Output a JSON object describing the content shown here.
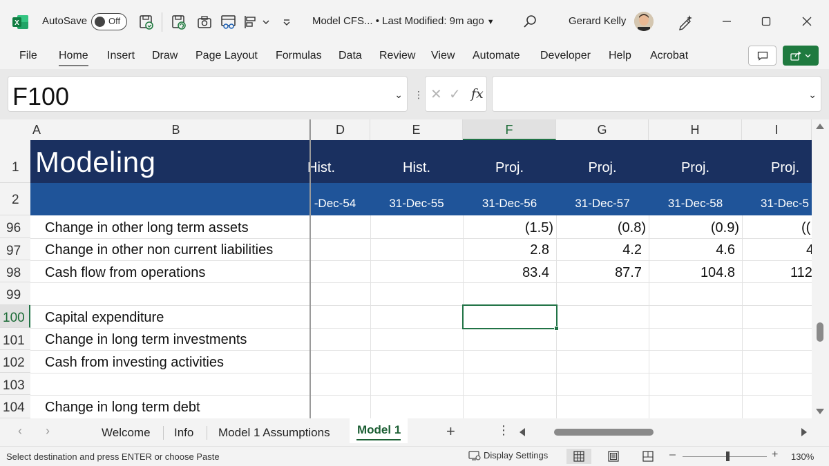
{
  "titlebar": {
    "autosave_label": "AutoSave",
    "autosave_state": "Off",
    "doc_title": "Model CFS... • Last Modified: 9m ago",
    "user_name": "Gerard Kelly",
    "brand_color": "#1f7a3f"
  },
  "ribbon": {
    "tabs": [
      "File",
      "Home",
      "Insert",
      "Draw",
      "Page Layout",
      "Formulas",
      "Data",
      "Review",
      "View",
      "Automate",
      "Developer",
      "Help",
      "Acrobat"
    ],
    "active_tab": "Home"
  },
  "formula_bar": {
    "name_box": "F100",
    "formula_value": ""
  },
  "grid": {
    "columns": [
      "A",
      "B",
      "D",
      "E",
      "F",
      "G",
      "H",
      "I"
    ],
    "selected_column": "F",
    "title": "Modeling",
    "period_types": [
      "Hist.",
      "Hist.",
      "Proj.",
      "Proj.",
      "Proj.",
      "Proj."
    ],
    "period_dates": [
      "-Dec-54",
      "31-Dec-55",
      "31-Dec-56",
      "31-Dec-57",
      "31-Dec-58",
      "31-Dec-5"
    ],
    "header_rows": [
      "1",
      "2"
    ],
    "rows": [
      {
        "num": "96",
        "label": "Change in other long term assets",
        "values": [
          "(1.5)",
          "(0.8)",
          "(0.9)",
          "(("
        ]
      },
      {
        "num": "97",
        "label": "Change in other non current liabilities",
        "values": [
          "2.8",
          "4.2",
          "4.6",
          "4"
        ]
      },
      {
        "num": "98",
        "label": "Cash flow from operations",
        "values": [
          "83.4",
          "87.7",
          "104.8",
          "112"
        ]
      },
      {
        "num": "99",
        "label": "",
        "values": [
          "",
          "",
          "",
          ""
        ]
      },
      {
        "num": "100",
        "label": "Capital expenditure",
        "values": [
          "",
          "",
          "",
          ""
        ]
      },
      {
        "num": "101",
        "label": "Change in long term investments",
        "values": [
          "",
          "",
          "",
          ""
        ]
      },
      {
        "num": "102",
        "label": "Cash from investing activities",
        "values": [
          "",
          "",
          "",
          ""
        ]
      },
      {
        "num": "103",
        "label": "",
        "values": [
          "",
          "",
          "",
          ""
        ]
      },
      {
        "num": "104",
        "label": "Change in long term debt",
        "values": [
          "",
          "",
          "",
          ""
        ]
      }
    ],
    "selected_row": "100",
    "header_band_dark": "#1a3060",
    "header_band_blue": "#1f5499"
  },
  "sheets": {
    "tabs": [
      "Welcome",
      "Info",
      "Model 1 Assumptions"
    ],
    "active": "Model 1",
    "add": "+",
    "more": "⋮"
  },
  "statusbar": {
    "message": "Select destination and press ENTER or choose Paste",
    "display_settings": "Display Settings",
    "zoom": "130%"
  }
}
